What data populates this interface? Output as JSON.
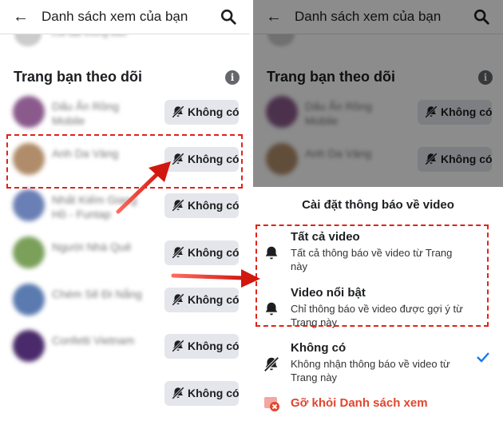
{
  "header": {
    "title": "Danh sách xem của bạn"
  },
  "peek": {
    "text": "Cài đặt thông báo"
  },
  "section": {
    "title": "Trang bạn theo dõi"
  },
  "pages": [
    {
      "name": "Dấu Ấn Rồng Mobile",
      "button": "Không có",
      "avatar_color": "#8a5a8c"
    },
    {
      "name": "Anh Da Vàng",
      "button": "Không có",
      "avatar_color": "#b08c6a"
    },
    {
      "name": "Nhất Kiếm Giang Hồ - Funtap",
      "button": "Không có",
      "avatar_color": "#6a7fb5"
    },
    {
      "name": "Người Nhà Quê",
      "button": "Không có",
      "avatar_color": "#7aa05a"
    },
    {
      "name": "Chém Sẽ Đi Nắng",
      "button": "Không có",
      "avatar_color": "#5a7ab0"
    },
    {
      "name": "Confetti Vietnam",
      "button": "Không có",
      "avatar_color": "#4a2a6a"
    },
    {
      "name": "",
      "button": "Không có",
      "avatar_color": ""
    }
  ],
  "sheet": {
    "title": "Cài đặt thông báo về video",
    "options": [
      {
        "title": "Tất cả video",
        "desc": "Tất cả thông báo về video từ Trang này",
        "icon": "bell-icon"
      },
      {
        "title": "Video nổi bật",
        "desc": "Chỉ thông báo về video được gợi ý từ Trang này",
        "icon": "bell-icon"
      },
      {
        "title": "Không có",
        "desc": "Không nhận thông báo về video từ Trang này",
        "icon": "bell-off-icon",
        "selected": true
      }
    ],
    "remove_label": "Gỡ khỏi Danh sách xem"
  },
  "colors": {
    "accent": "#1877f2",
    "annotation": "#e0231b",
    "danger": "#e0462f",
    "button_bg": "#e4e6eb"
  }
}
